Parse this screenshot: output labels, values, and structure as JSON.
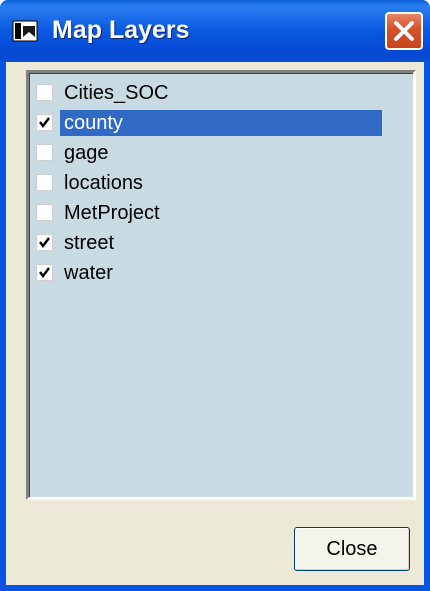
{
  "window": {
    "title": "Map Layers",
    "colors": {
      "titlebar": "#0854e3",
      "selection": "#316ac5",
      "list_bg": "#c8dbe3",
      "dialog_bg": "#ece9d8"
    }
  },
  "layers": [
    {
      "label": "Cities_SOC",
      "checked": false,
      "selected": false
    },
    {
      "label": "county",
      "checked": true,
      "selected": true
    },
    {
      "label": "gage",
      "checked": false,
      "selected": false
    },
    {
      "label": "locations",
      "checked": false,
      "selected": false
    },
    {
      "label": "MetProject",
      "checked": false,
      "selected": false
    },
    {
      "label": "street",
      "checked": true,
      "selected": false
    },
    {
      "label": "water",
      "checked": true,
      "selected": false
    }
  ],
  "buttons": {
    "close_label": "Close"
  },
  "icons": {
    "title": "map-window-icon",
    "close": "close-icon",
    "check": "checkmark-icon"
  }
}
